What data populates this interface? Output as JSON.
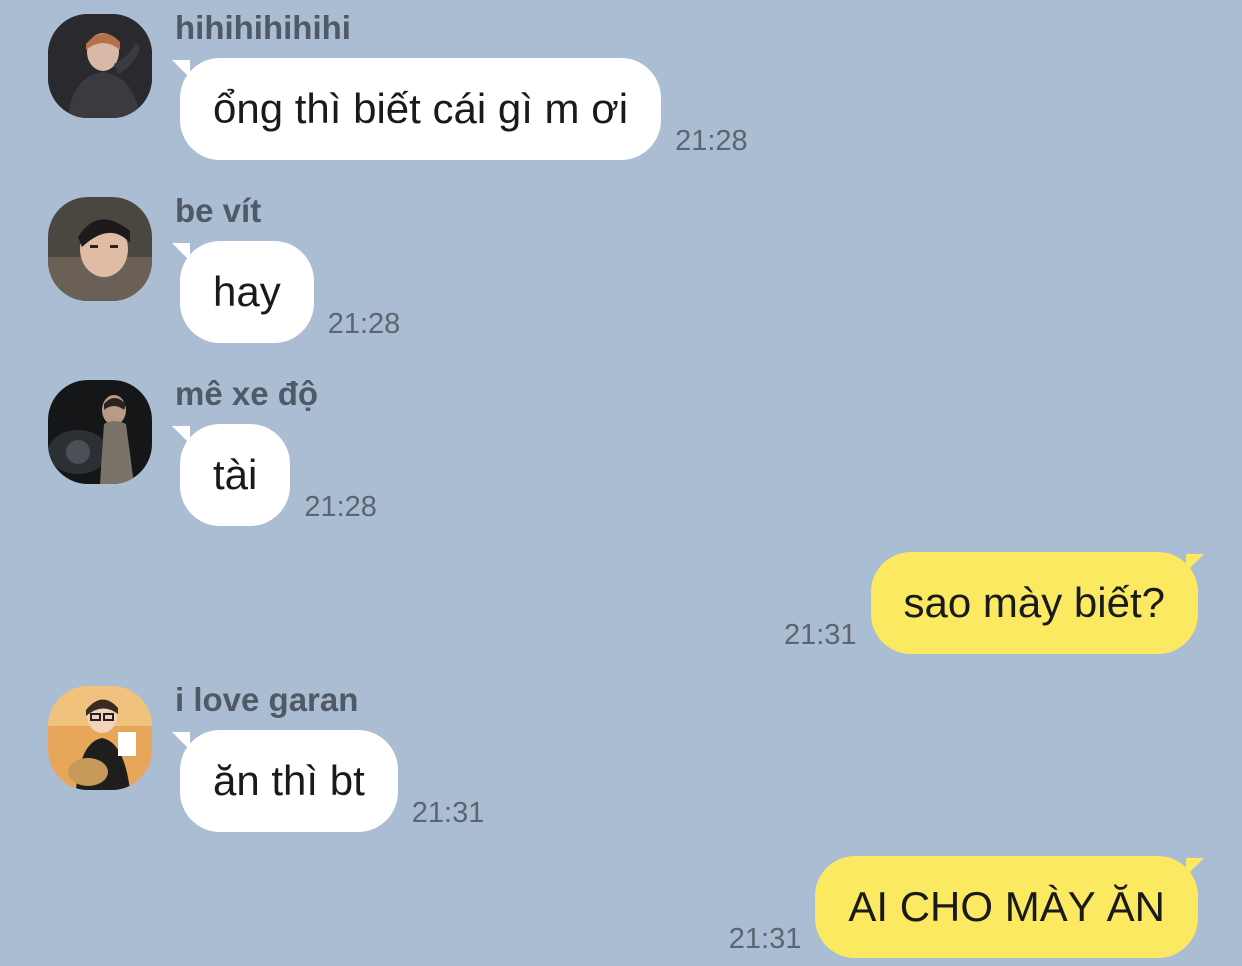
{
  "messages": [
    {
      "direction": "in",
      "sender": "hihihihihihi",
      "text": "ổng thì biết cái gì m ơi",
      "time": "21:28",
      "avatar_icon": "person-photo-avatar-dark-jacket"
    },
    {
      "direction": "in",
      "sender": "be vít",
      "text": "hay",
      "time": "21:28",
      "avatar_icon": "person-photo-avatar-selfie"
    },
    {
      "direction": "in",
      "sender": "mê xe độ",
      "text": "tài",
      "time": "21:28",
      "avatar_icon": "person-photo-avatar-motorbike"
    },
    {
      "direction": "out",
      "text": "sao mày biết?",
      "time": "21:31"
    },
    {
      "direction": "in",
      "sender": "i love garan",
      "text": "ăn thì bt",
      "time": "21:31",
      "avatar_icon": "person-photo-avatar-eating"
    },
    {
      "direction": "out",
      "text": "AI CHO MÀY ĂN",
      "time": "21:31"
    }
  ],
  "colors": {
    "background": "#abbdd2",
    "incoming_bubble": "#ffffff",
    "outgoing_bubble": "#fbe962",
    "sender_name": "#505a66",
    "timestamp": "#5c6570"
  }
}
